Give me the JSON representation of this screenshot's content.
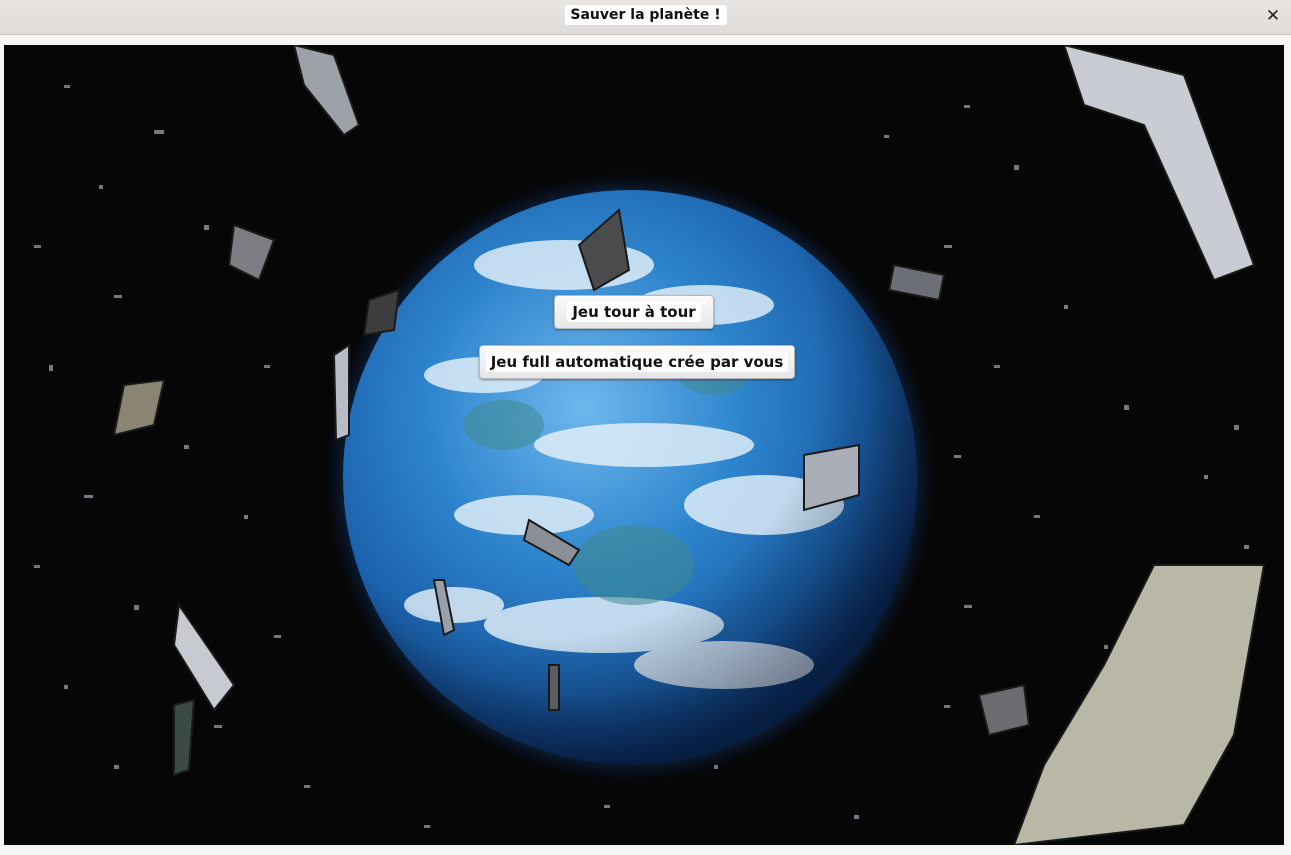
{
  "window": {
    "title": "Sauver la planète !",
    "close_icon": "close-icon"
  },
  "menu": {
    "turn_based_label": "Jeu tour à tour",
    "auto_label": "Jeu full automatique crée par vous"
  },
  "scene": {
    "background": "#060607",
    "planet_color": "#2a7fc8",
    "atmosphere_color": "#3fa0ff",
    "debris_color": "#8c8f94"
  }
}
